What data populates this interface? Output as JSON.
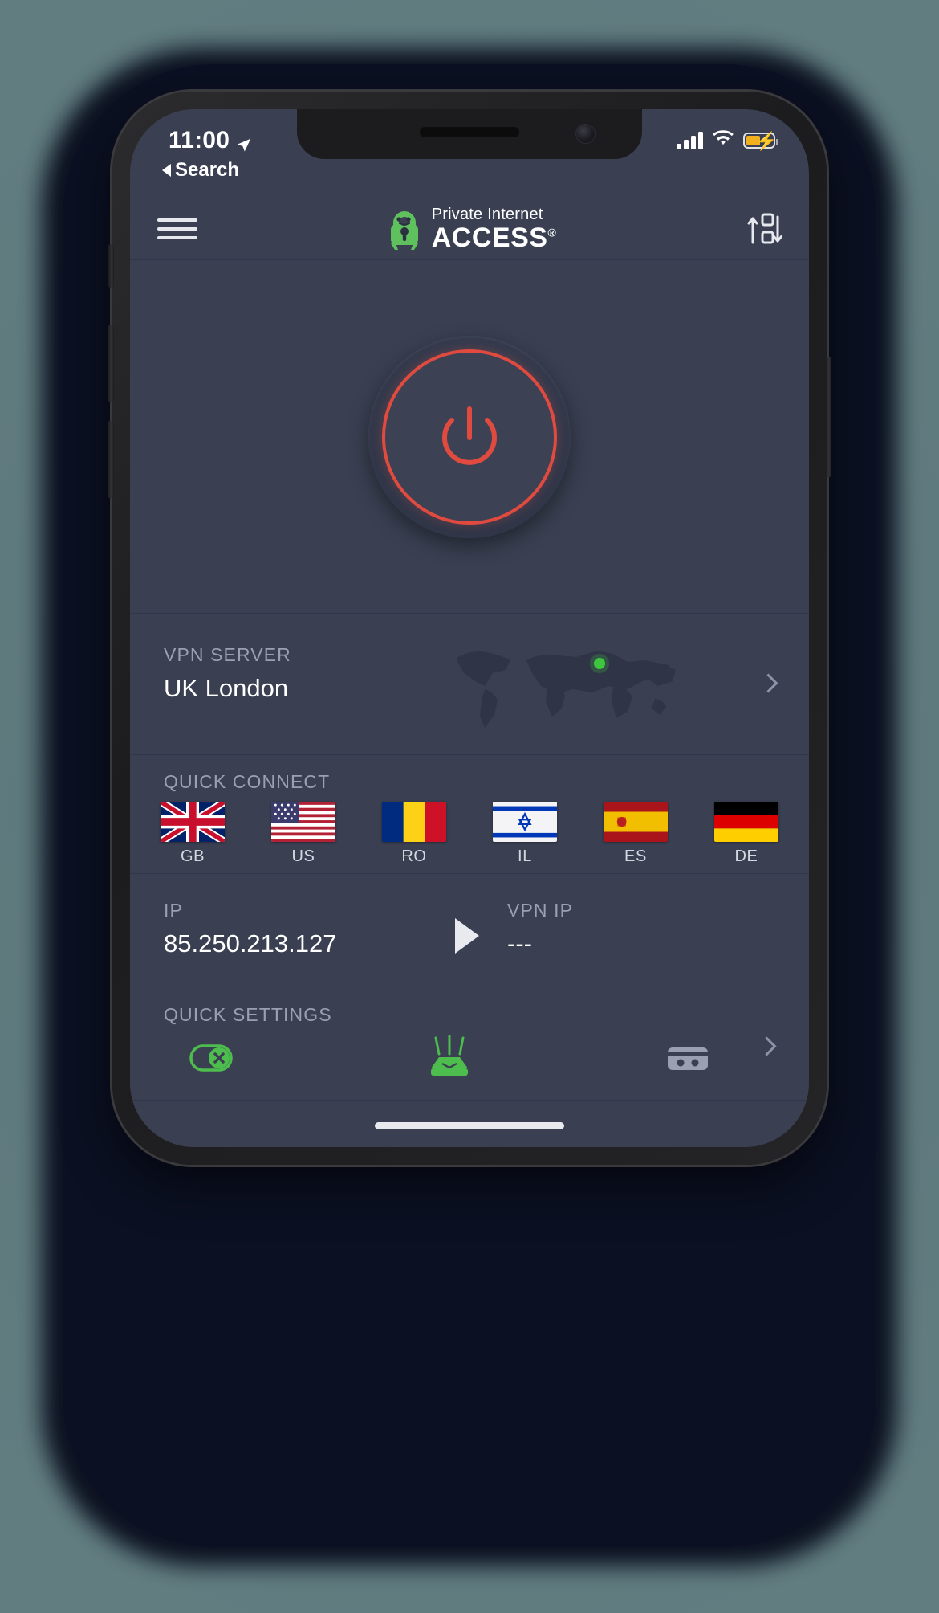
{
  "status_bar": {
    "time": "11:00",
    "back_label": "Search",
    "location_icon": "location-arrow-icon",
    "signal_icon": "cellular-bars-icon",
    "wifi_icon": "wifi-icon",
    "battery_icon": "battery-charging-icon"
  },
  "header": {
    "menu_icon": "hamburger-menu-icon",
    "logo_line1": "Private Internet",
    "logo_line2": "ACCESS",
    "logo_registered": "®",
    "logo_icon": "pia-padlock-robot-icon",
    "network_icon": "network-transfer-icon"
  },
  "connect": {
    "power_icon": "power-button-icon",
    "state": "disconnected",
    "accent_color": "#e04a3f"
  },
  "vpn_server": {
    "label": "VPN SERVER",
    "value": "UK London",
    "map_icon": "world-map-icon",
    "marker_color": "#3ec73e",
    "chevron_icon": "chevron-right-icon"
  },
  "quick_connect": {
    "label": "QUICK CONNECT",
    "regions": [
      {
        "code": "GB",
        "flag": "flag-gb-icon"
      },
      {
        "code": "US",
        "flag": "flag-us-icon"
      },
      {
        "code": "RO",
        "flag": "flag-ro-icon"
      },
      {
        "code": "IL",
        "flag": "flag-il-icon"
      },
      {
        "code": "ES",
        "flag": "flag-es-icon"
      },
      {
        "code": "DE",
        "flag": "flag-de-icon"
      }
    ]
  },
  "ip_info": {
    "ip_label": "IP",
    "ip_value": "85.250.213.127",
    "arrow_icon": "play-arrow-icon",
    "vpn_ip_label": "VPN IP",
    "vpn_ip_value": "---"
  },
  "quick_settings": {
    "label": "QUICK SETTINGS",
    "items": [
      {
        "icon": "kill-switch-icon",
        "color": "#4dbd4d"
      },
      {
        "icon": "router-icon",
        "color": "#4dbd4d"
      },
      {
        "icon": "network-card-icon",
        "color": "#9aa0b2"
      }
    ],
    "chevron_icon": "chevron-right-icon"
  },
  "home_indicator": "home-indicator-bar"
}
